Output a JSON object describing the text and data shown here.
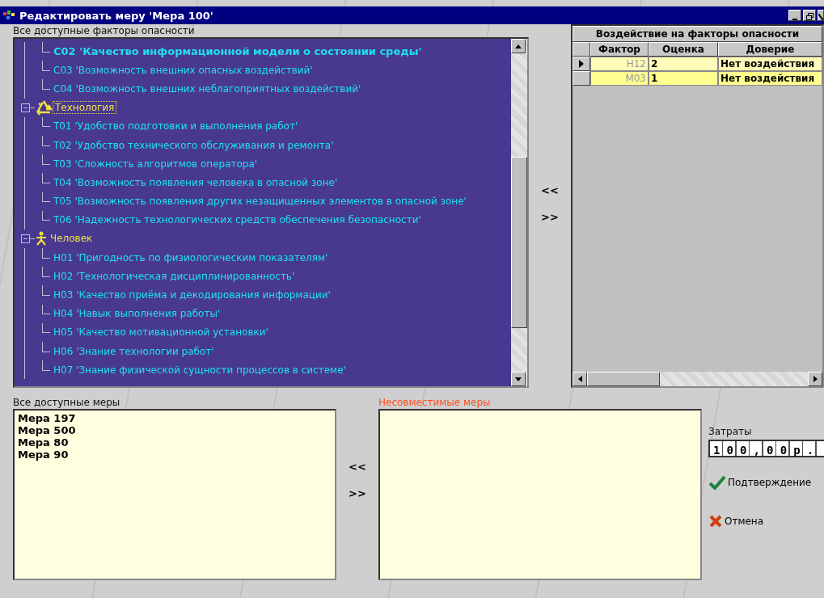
{
  "window": {
    "title": "Редактировать меру 'Мера 100'"
  },
  "hazards": {
    "label": "Все доступные факторы опасности",
    "items": [
      {
        "kind": "leaf",
        "code": "С02",
        "label": "'Качество информационной модели о состоянии среды'",
        "selected": true
      },
      {
        "kind": "leaf",
        "code": "С03",
        "label": "'Возможность внешних опасных воздействий'",
        "selected": false
      },
      {
        "kind": "leaf",
        "code": "С04",
        "label": "'Возможность внешних неблагоприятных воздействий'",
        "selected": false
      },
      {
        "kind": "technology",
        "label": "Технология",
        "expanded": true,
        "focused": true,
        "children": [
          {
            "kind": "leaf",
            "code": "Т01",
            "label": "'Удобство подготовки и выполнения работ'",
            "selected": false
          },
          {
            "kind": "leaf",
            "code": "Т02",
            "label": "'Удобство технического обслуживания и ремонта'",
            "selected": false
          },
          {
            "kind": "leaf",
            "code": "Т03",
            "label": "'Сложность алгоритмов оператора'",
            "selected": false
          },
          {
            "kind": "leaf",
            "code": "Т04",
            "label": "'Возможность появления человека в опасной зоне'",
            "selected": false
          },
          {
            "kind": "leaf",
            "code": "Т05",
            "label": "'Возможность появления других незащищенных элементов в опасной зоне'",
            "selected": false
          },
          {
            "kind": "leaf",
            "code": "Т06",
            "label": "'Надежность технологических средств обеспечения безопасности'",
            "selected": false
          }
        ]
      },
      {
        "kind": "human",
        "label": "Человек",
        "expanded": true,
        "focused": false,
        "children": [
          {
            "kind": "leaf",
            "code": "Н01",
            "label": "'Пригодность по физиологическим показателям'",
            "selected": false
          },
          {
            "kind": "leaf",
            "code": "Н02",
            "label": "'Технологическая дисциплинированность'",
            "selected": false
          },
          {
            "kind": "leaf",
            "code": "Н03",
            "label": "'Качество приёма и декодирования информации'",
            "selected": false
          },
          {
            "kind": "leaf",
            "code": "Н04",
            "label": "'Навык выполнения работы'",
            "selected": false
          },
          {
            "kind": "leaf",
            "code": "Н05",
            "label": "'Качество мотивационной установки'",
            "selected": false
          },
          {
            "kind": "leaf",
            "code": "Н06",
            "label": "'Знание технологии работ'",
            "selected": false
          },
          {
            "kind": "leaf",
            "code": "Н07",
            "label": "'Знание физической сущности процессов в системе'",
            "selected": false
          }
        ]
      }
    ]
  },
  "transfer_buttons": [
    "<<",
    ">>"
  ],
  "impact_table": {
    "title": "Воздействие на факторы опасности",
    "columns": [
      "Фактор",
      "Оценка",
      "Доверие"
    ],
    "rows": [
      {
        "selected": true,
        "cells": [
          "Н12",
          "2",
          "Нет воздействия"
        ]
      },
      {
        "selected": false,
        "cells": [
          "М03",
          "1",
          "Нет воздействия"
        ]
      }
    ]
  },
  "measures": {
    "label": "Все доступные меры",
    "items": [
      "Мера 197",
      "Мера 500",
      "Мера 80",
      "Мера 90"
    ]
  },
  "measure_buttons": [
    "<<",
    ">>"
  ],
  "incompatible": {
    "label": "Несовместимые меры"
  },
  "cost": {
    "label": "Затраты",
    "value": "100,00р."
  },
  "actions": [
    {
      "kind": "confirm",
      "label": "Подтверждение"
    },
    {
      "kind": "cancel",
      "label": "Отмена"
    }
  ]
}
